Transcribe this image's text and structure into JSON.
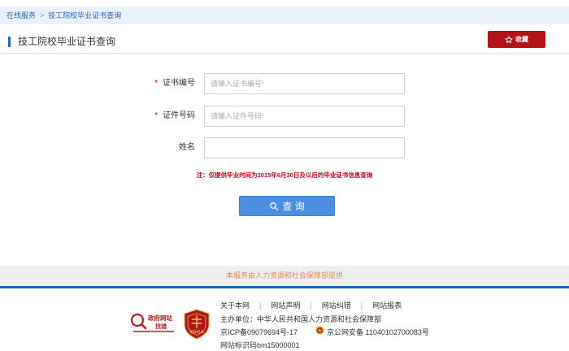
{
  "breadcrumb": {
    "items": [
      "在线服务",
      "技工院校毕业证书查询"
    ],
    "separator": ">"
  },
  "page_title": "技工院校毕业证书查询",
  "favorite_label": "收藏",
  "form": {
    "cert_no": {
      "label": "证书编号",
      "placeholder": "请输入证书编号!",
      "required_mark": "*"
    },
    "id_no": {
      "label": "证件号码",
      "placeholder": "请输入证件号码!",
      "required_mark": "*"
    },
    "name": {
      "label": "姓名",
      "placeholder": ""
    }
  },
  "note": "注：仅提供毕业时间为2015年6月30日及以后的毕业证书信息查询",
  "query_label": "查 询",
  "provided_by": "本服务由人力资源和社会保障部提供",
  "footer": {
    "links": [
      "关于本网",
      "网站声明",
      "网站纠错",
      "网站报表"
    ],
    "link_separator": "|",
    "sponsor": "主办单位：中华人民共和国人力资源和社会保障部",
    "icp": "京ICP备09079694号-17",
    "police": "京公网安备 11040102700083号",
    "site_id": "网站标识码bm15000001",
    "gov_badge_line1": "政府网站",
    "gov_badge_line2": "找错",
    "emblem_text": "党政机关"
  },
  "colors": {
    "brand_blue": "#2b62b8",
    "favorite_red": "#b3141b",
    "query_blue": "#4b8fe0",
    "note_red": "#d0021b"
  }
}
